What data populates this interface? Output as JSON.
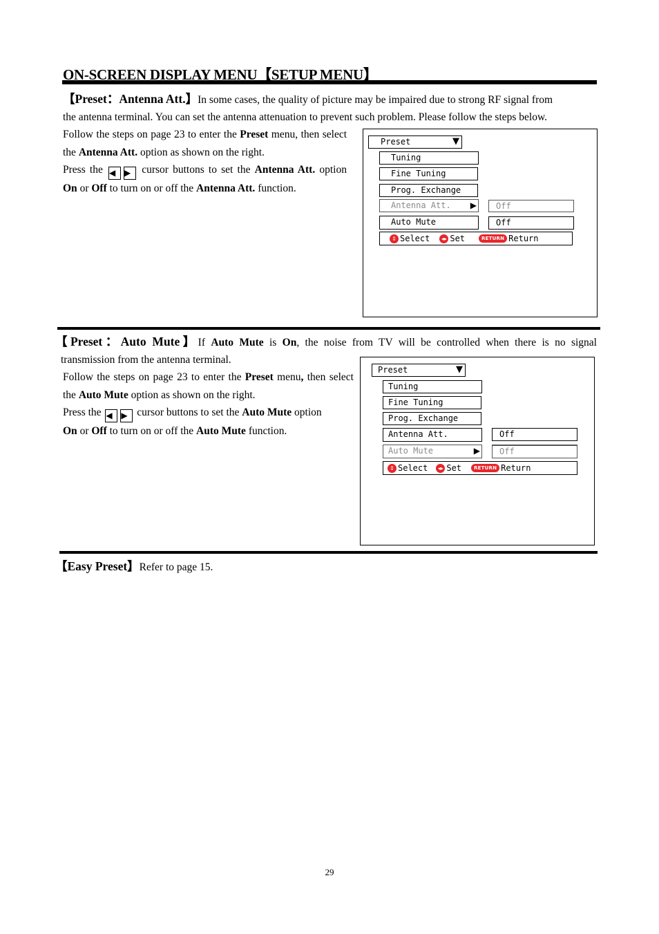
{
  "page": {
    "title": "ON-SCREEN DISPLAY MENU【SETUP MENU】",
    "page_number": "29"
  },
  "section_antenna": {
    "heading": "【Preset：Antenna Att.】",
    "intro_line1": "In some cases, the quality of picture may be impaired due to strong RF signal from",
    "intro_line2": "the antenna terminal. You can set the antenna attenuation to prevent such problem. Please follow the steps below.",
    "steps": {
      "s1a": "Follow the steps on page 23 to enter the ",
      "s1b": "Preset",
      "s1c": " menu, then select the ",
      "s1d": "Antenna Att.",
      "s1e": " option as shown on the right.",
      "s2a": "Press the",
      "s2b": "cursor buttons to set the ",
      "s2c": "Antenna Att.",
      "s2d": " option ",
      "s2e": "On",
      "s2f": " or ",
      "s2g": "Off",
      "s2h": " to turn on or off the ",
      "s2i": "Antenna Att.",
      "s2j": " function."
    },
    "osd": {
      "header": "Preset",
      "items": [
        "Tuning",
        "Fine Tuning",
        "Prog. Exchange",
        "Antenna Att.",
        "Auto Mute"
      ],
      "values": {
        "antenna_att": "Off",
        "auto_mute": "Off"
      },
      "selected": "Antenna Att.",
      "help": {
        "select": "Select",
        "set": "Set",
        "return_badge": "RETURN",
        "return": "Return"
      }
    }
  },
  "section_mute": {
    "heading": "【Preset：Auto Mute】",
    "intro": {
      "a": "If ",
      "b": "Auto Mute",
      "c": " is ",
      "d": "On",
      "e": ", the noise from TV will be controlled when there is no signal",
      "line2": "transmission from the antenna terminal."
    },
    "steps": {
      "s1a": "Follow the steps on page 23 to enter the ",
      "s1b": "Preset",
      "s1c": " menu",
      "s1comma": ",",
      "s1d": " then select the ",
      "s1e": "Auto Mute",
      "s1f": " option as shown on the right.",
      "s2a": "Press the",
      "s2b": "cursor buttons to set the ",
      "s2c": "Auto Mute",
      "s2d": " option ",
      "s2e": "On",
      "s2f": " or ",
      "s2g": "Off",
      "s2h": " to turn on or off the ",
      "s2i": "Auto Mute",
      "s2j": " function."
    },
    "osd": {
      "header": "Preset",
      "items": [
        "Tuning",
        "Fine Tuning",
        "Prog. Exchange",
        "Antenna Att.",
        "Auto Mute"
      ],
      "values": {
        "antenna_att": "Off",
        "auto_mute": "Off"
      },
      "selected": "Auto Mute",
      "help": {
        "select": "Select",
        "set": "Set",
        "return_badge": "RETURN",
        "return": "Return"
      }
    }
  },
  "section_easy": {
    "heading": "【Easy Preset】",
    "text": "Refer to page 15."
  },
  "icons": {
    "left_arrow": "◀",
    "right_arrow": "▶",
    "down_arrow": "▼",
    "updown": "⇕",
    "leftright": "◂▸"
  },
  "colors": {
    "accent_red": "#e8262a",
    "dim_text": "#8a8a8a"
  }
}
